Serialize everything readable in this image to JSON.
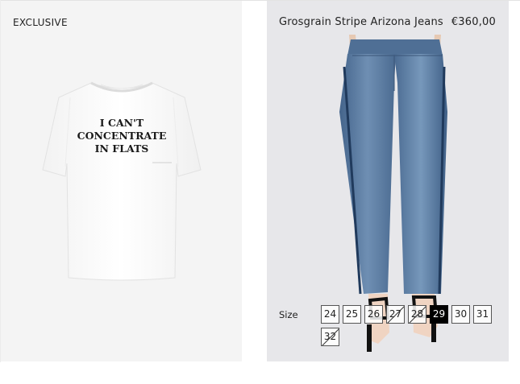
{
  "left_product": {
    "badge": "EXCLUSIVE",
    "print_lines": [
      "I CAN'T",
      "CONCENTRATE",
      "IN FLATS"
    ]
  },
  "right_product": {
    "name": "Grosgrain Stripe Arizona Jeans",
    "price": "€360,00",
    "size_label": "Size",
    "sizes": [
      {
        "label": "24",
        "state": "available"
      },
      {
        "label": "25",
        "state": "available"
      },
      {
        "label": "26",
        "state": "available"
      },
      {
        "label": "27",
        "state": "unavailable"
      },
      {
        "label": "28",
        "state": "unavailable"
      },
      {
        "label": "29",
        "state": "selected"
      },
      {
        "label": "30",
        "state": "available"
      },
      {
        "label": "31",
        "state": "available"
      },
      {
        "label": "32",
        "state": "unavailable"
      }
    ]
  },
  "colors": {
    "card_left_bg": "#f4f4f4",
    "card_right_bg": "#e7e7ea",
    "denim": "#4f6f95",
    "selected_size": "#000000"
  }
}
